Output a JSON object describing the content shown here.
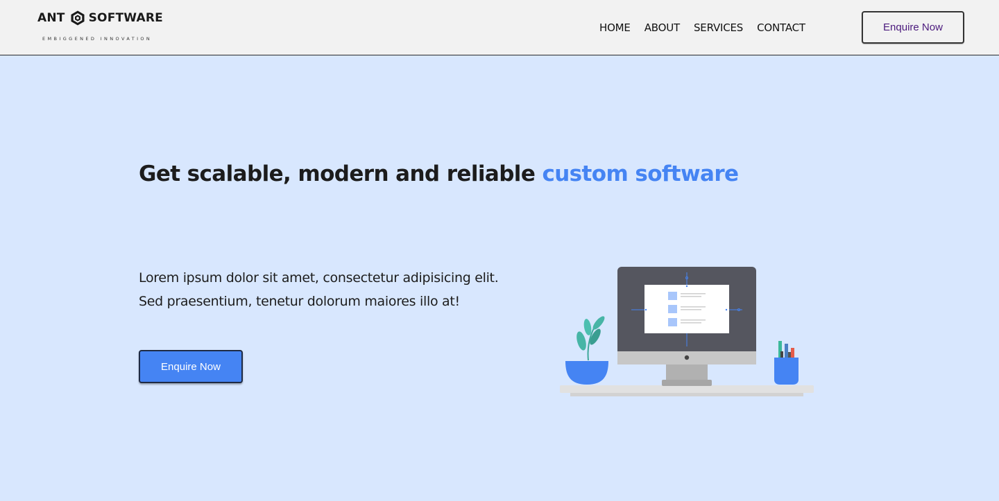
{
  "header": {
    "logo": {
      "word_left": "ANT",
      "word_right": "SOFTWARE",
      "tagline": "EMBIGGENED INNOVATION",
      "icon": "hexagon-logo-icon"
    },
    "nav": [
      "HOME",
      "ABOUT",
      "SERVICES",
      "CONTACT"
    ],
    "cta_label": "Enquire Now"
  },
  "hero": {
    "title_main": "Get scalable, modern and reliable ",
    "title_accent": "custom software",
    "description": "Lorem ipsum dolor sit amet, consectetur adipisicing elit. Sed praesentium, tenetur dolorum maiores illo at!",
    "cta_label": "Enquire Now",
    "illustration": "desk-computer-illustration"
  },
  "colors": {
    "header_bg": "#f2f2f2",
    "hero_bg": "#d8e7fe",
    "accent": "#4584f3",
    "text": "#1c1c1c",
    "header_cta_text": "#4b1a7d"
  }
}
